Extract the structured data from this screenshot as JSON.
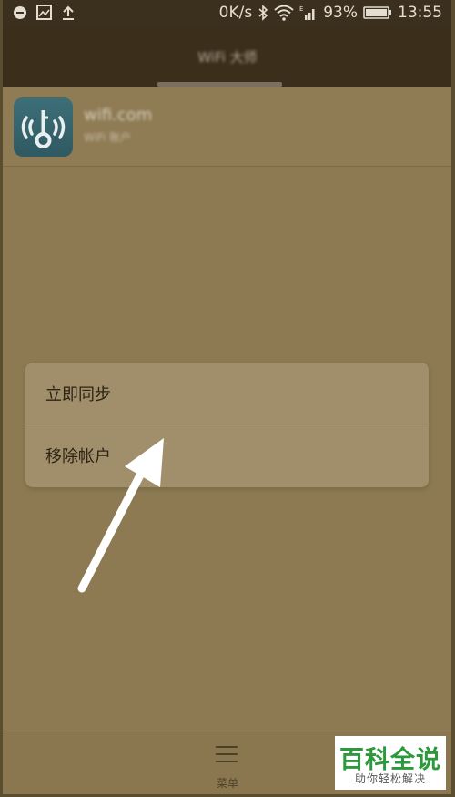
{
  "status_bar": {
    "network_speed": "0K/s",
    "battery": "93%",
    "time": "13:55",
    "icons": [
      "message-icon",
      "image-icon",
      "upload-icon",
      "bluetooth-icon",
      "wifi-icon",
      "signal-icon",
      "battery-icon"
    ]
  },
  "header": {
    "title": "WiFi 大师"
  },
  "account": {
    "name": "wifi.com",
    "subtitle": "WiFi 账户"
  },
  "popup_menu": {
    "items": [
      {
        "label": "立即同步"
      },
      {
        "label": "移除帐户"
      }
    ]
  },
  "bottom_bar": {
    "menu_label": "菜单"
  },
  "watermark": {
    "title": "百科全说",
    "subtitle": "助你轻松解决"
  },
  "colors": {
    "arrow": "#ffffff",
    "overlay": "#8d7a52",
    "popup": "#a18f6c",
    "watermark_green": "#2c9a3a"
  }
}
